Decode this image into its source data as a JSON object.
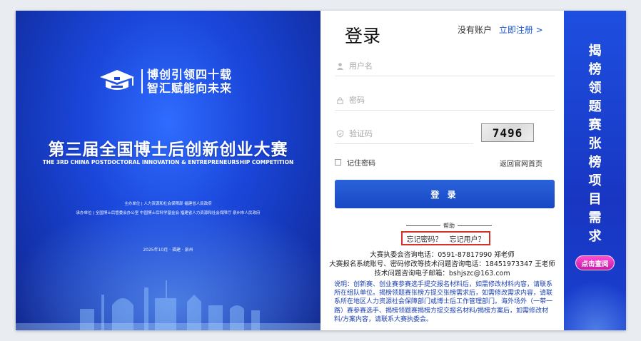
{
  "banner": {
    "logo_line1": "博创引领四十载",
    "logo_line2": "智汇赋能向未来",
    "title": "第三届全国博士后创新创业大赛",
    "subtitle": "THE 3RD CHINA POSTDOCTORAL INNOVATION & ENTREPRENEURSHIP COMPETITION",
    "host": "主办单位 | 人力资源和社会保障部  福建省人民政府",
    "organizer": "承办单位 | 全国博士后管委会办公室  中国博士后科学基金会  福建省人力资源和社会保障厅  泉州市人民政府",
    "date": "2025年10月 · 福建 · 泉州"
  },
  "login": {
    "title": "登录",
    "no_account": "没有账户",
    "register_link": "立即注册 >",
    "username_placeholder": "用户名",
    "password_placeholder": "密码",
    "captcha_placeholder": "验证码",
    "captcha_code": "7496",
    "remember_label": "记住密码",
    "back_home": "返回官网首页",
    "login_button": "登 录",
    "help_label": "帮助",
    "forgot_password": "忘记密码？",
    "forgot_user": "忘记用户？",
    "contact_line1": "大赛执委会咨询电话：0591-87817990 郑老师",
    "contact_line2": "大赛报名系统账号、密码修改等技术问题咨询电话：18451973347 王老师",
    "contact_line3": "技术问题咨询电子邮箱：bshjszc@163.com",
    "note": "说明：创新赛、创业赛参赛选手提交报名材料后，如需修改材料内容，请联系所在组队单位。揭榜领题赛张榜方提交张榜需求后，如需修改需求内容，请联系所在地区人力资源社会保障部门或博士后工作管理部门。海外场外（一带一路）赛参赛选手、揭榜领题赛揭榜方提交报名材料/揭榜方案后，如需修改材料/方案内容，请联系大赛执委会。"
  },
  "strip": {
    "chars": [
      "揭",
      "榜",
      "领",
      "题",
      "赛",
      "张",
      "榜",
      "项",
      "目",
      "需",
      "求"
    ],
    "query_button": "点击查阅"
  },
  "colors": {
    "accent": "#1a56d6",
    "banner_blue": "#1a46d9",
    "highlight_red": "#d4322a",
    "note_blue": "#1a3fb0",
    "pink_button": "#e22ec0"
  },
  "icons": [
    "logo-mark-icon",
    "user-icon",
    "lock-icon",
    "shield-icon",
    "checkbox-icon"
  ]
}
